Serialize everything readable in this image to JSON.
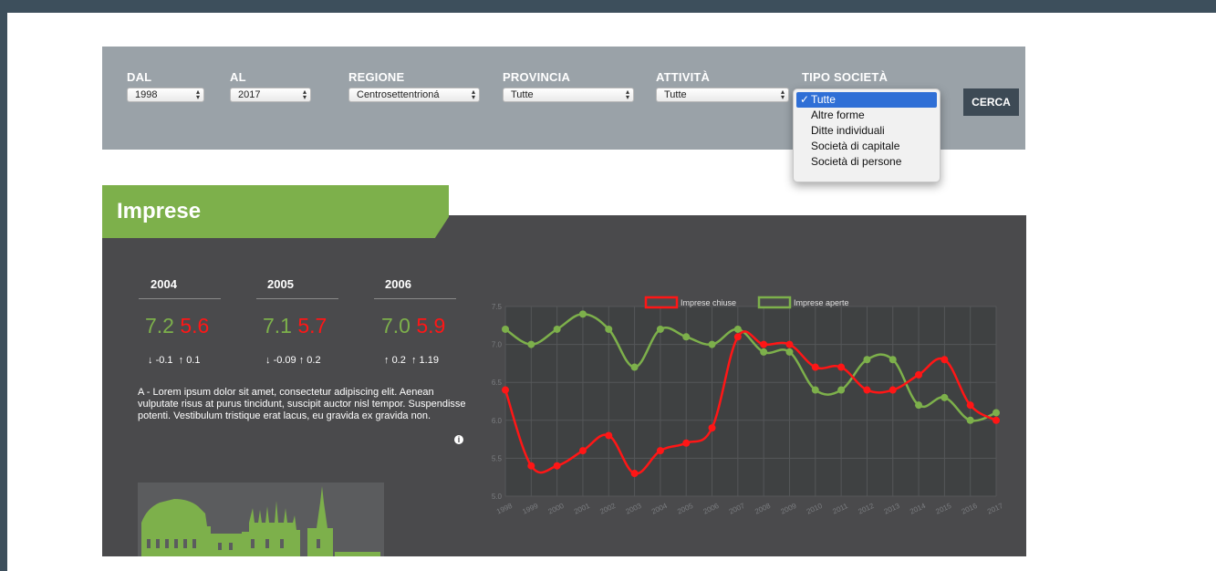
{
  "filters": {
    "dal": {
      "label": "DAL",
      "value": "1998"
    },
    "al": {
      "label": "AL",
      "value": "2017"
    },
    "regione": {
      "label": "REGIONE",
      "value": "Centrosettentrioná"
    },
    "provincia": {
      "label": "PROVINCIA",
      "value": "Tutte"
    },
    "attivita": {
      "label": "ATTIVITÀ",
      "value": "Tutte"
    },
    "tipo_societa": {
      "label": "TIPO SOCIETÀ"
    },
    "search_label": "CERCA",
    "dropdown_options": [
      "Tutte",
      "Altre forme",
      "Ditte individuali",
      "Società di capitale",
      "Società di persone"
    ],
    "dropdown_selected": "Tutte",
    "check_glyph": "✓"
  },
  "panel": {
    "title": "Imprese",
    "stats": [
      {
        "year": "2004",
        "open": "7.2",
        "closed": "5.6",
        "delta_down": "-0.1",
        "delta_up": "0.1",
        "down_arrow": "↓",
        "up_arrow": "↑"
      },
      {
        "year": "2005",
        "open": "7.1",
        "closed": "5.7",
        "delta_down": "-0.09",
        "delta_up": "0.2",
        "down_arrow": "↓",
        "up_arrow": "↑"
      },
      {
        "year": "2006",
        "open": "7.0",
        "closed": "5.9",
        "delta_down": "0.2",
        "delta_up": "1.19",
        "down_arrow": "↑",
        "up_arrow": "↑"
      }
    ],
    "description": "A - Lorem ipsum dolor sit amet, consectetur adipiscing elit. Aenean vulputate risus at purus tincidunt, suscipit auctor nisl tempor. Suspendisse potenti. Vestibulum tristique erat lacus, eu gravida ex gravida non.",
    "info_glyph": "i"
  },
  "colors": {
    "green": "#7db04b",
    "red": "#ff1616",
    "panel": "#4a4a4c",
    "filterbar": "#9aa2a8"
  },
  "chart_data": {
    "type": "line",
    "categories": [
      "1998",
      "1999",
      "2000",
      "2001",
      "2002",
      "2003",
      "2004",
      "2005",
      "2006",
      "2007",
      "2008",
      "2009",
      "2010",
      "2011",
      "2012",
      "2013",
      "2014",
      "2015",
      "2016",
      "2017"
    ],
    "series": [
      {
        "name": "Imprese chiuse",
        "color": "#ff1616",
        "values": [
          6.4,
          5.4,
          5.4,
          5.6,
          5.8,
          5.3,
          5.6,
          5.7,
          5.9,
          7.1,
          7.0,
          7.0,
          6.7,
          6.7,
          6.4,
          6.4,
          6.6,
          6.8,
          6.2,
          6.0
        ]
      },
      {
        "name": "Imprese aperte",
        "color": "#7db04b",
        "values": [
          7.2,
          7.0,
          7.2,
          7.4,
          7.2,
          6.7,
          7.2,
          7.1,
          7.0,
          7.2,
          6.9,
          6.9,
          6.4,
          6.4,
          6.8,
          6.8,
          6.2,
          6.3,
          6.0,
          6.1
        ]
      }
    ],
    "ylim": [
      5.0,
      7.5
    ],
    "yticks": [
      "5.0",
      "5.5",
      "6.0",
      "6.5",
      "7.0",
      "7.5"
    ],
    "legend": "top",
    "grid": true
  }
}
